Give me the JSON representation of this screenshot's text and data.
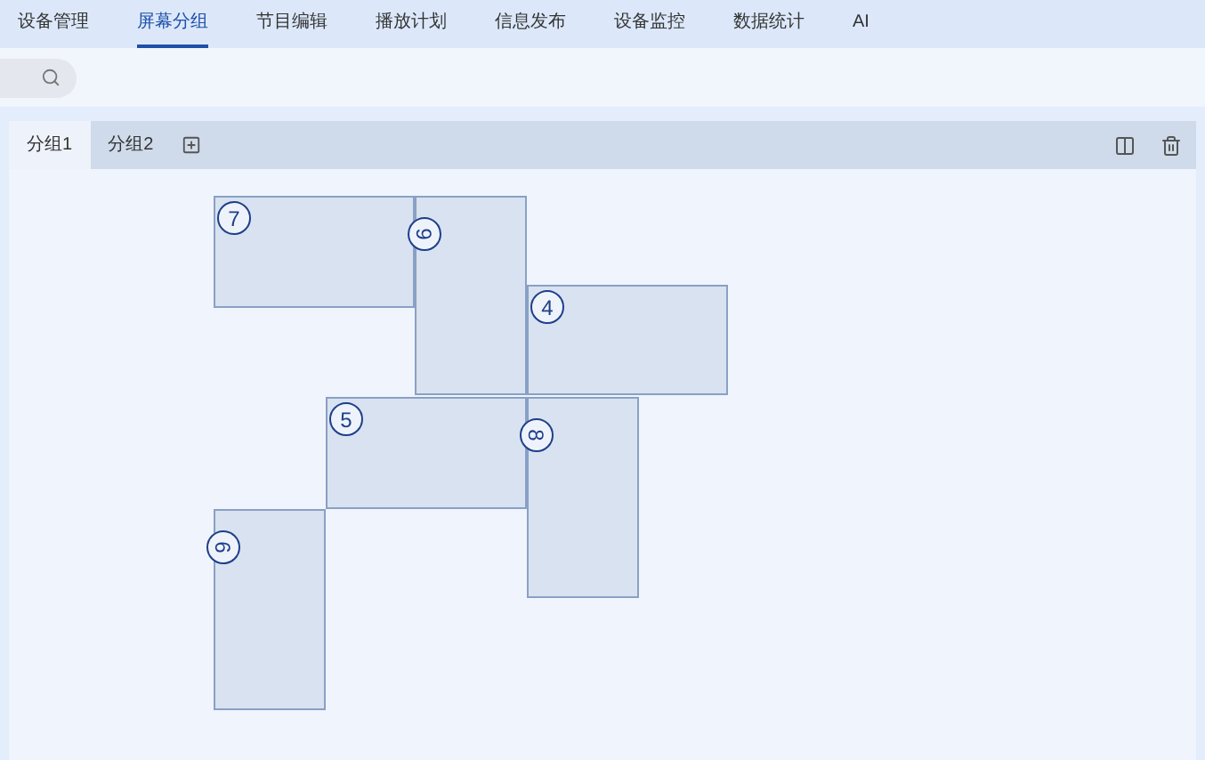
{
  "nav": [
    {
      "label": "设备管理",
      "selected": false
    },
    {
      "label": "屏幕分组",
      "selected": true
    },
    {
      "label": "节目编辑",
      "selected": false
    },
    {
      "label": "播放计划",
      "selected": false
    },
    {
      "label": "信息发布",
      "selected": false
    },
    {
      "label": "设备监控",
      "selected": false
    },
    {
      "label": "数据统计",
      "selected": false
    },
    {
      "label": "AI",
      "selected": false
    }
  ],
  "group_tabs": [
    {
      "label": "分组1",
      "selected": true
    },
    {
      "label": "分组2",
      "selected": false
    }
  ],
  "screens": [
    {
      "label": "7",
      "rotated": false
    },
    {
      "label": "9",
      "rotated": true
    },
    {
      "label": "4",
      "rotated": false
    },
    {
      "label": "5",
      "rotated": false
    },
    {
      "label": "8",
      "rotated": true
    },
    {
      "label": "6",
      "rotated": true
    }
  ]
}
